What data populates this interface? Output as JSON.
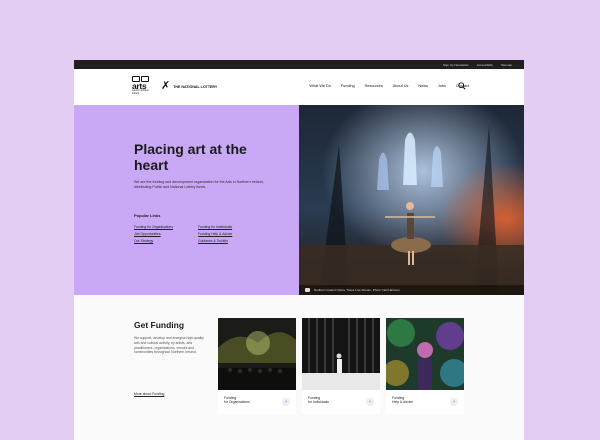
{
  "utility_bar": {
    "items": [
      "Sign Up Newsletter",
      "Accessibility",
      "Sitemap"
    ]
  },
  "logos": {
    "arts_word": "arts",
    "arts_small": "council northern ireland",
    "lottery_text": "THE NATIONAL LOTTERY"
  },
  "nav": {
    "items": [
      "What We Do",
      "Funding",
      "Resources",
      "About Us",
      "News",
      "Jobs",
      "Contact"
    ]
  },
  "hero": {
    "title": "Placing art at the heart",
    "description": "We are the funding and development organisation for the Arts in Northern Ireland, distributing Public and National Lottery funds.",
    "popular_title": "Popular Links",
    "links": [
      "Funding for Organisations",
      "Funding for Individuals",
      "Job Opportunities",
      "Funding Help & Advice",
      "Our Strategy",
      "Guidance & Toolkits"
    ],
    "caption": "Northern Ireland Opera, Tosca Live Stream, Photo: Neil Harrison"
  },
  "funding": {
    "title": "Get Funding",
    "description": "We support, develop and energise high-quality arts and cultural activity, by artists, arts practitioners, organisations, venues and communities throughout Northern Ireland.",
    "more_link": "More about Funding",
    "cards": [
      {
        "line1": "Funding",
        "line2": "for Organisations"
      },
      {
        "line1": "Funding",
        "line2": "for Individuals"
      },
      {
        "line1": "Funding",
        "line2": "Help & Advice"
      }
    ]
  },
  "colors": {
    "background": "#e3cdf3",
    "hero_panel": "#c9a9f6",
    "topbar": "#1f1f1f"
  },
  "icons": [
    "search-icon",
    "camera-icon",
    "arrow-right-icon",
    "national-lottery-crossed-fingers-icon"
  ]
}
